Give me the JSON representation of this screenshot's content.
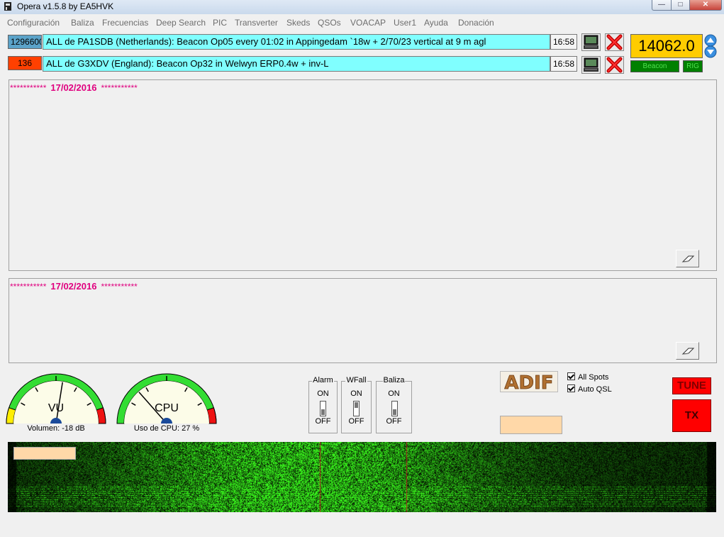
{
  "window": {
    "title": "Opera v1.5.8    by EA5HVK",
    "minimize": "—",
    "maximize": "□",
    "close": "✕"
  },
  "menu": [
    "Configuración",
    "Baliza",
    "Frecuencias",
    "Deep Search",
    "PIC",
    "Transverter",
    "Skeds",
    "QSOs",
    "VOACAP",
    "User1",
    "Ayuda",
    "Donación"
  ],
  "spots": [
    {
      "freq": "1296600",
      "freq_bg": "#5ba3c9",
      "message": "ALL de PA1SDB (Netherlands): Beacon Op05 every 01:02 in Appingedam `18w + 2/70/23 vertical at 9 m agl",
      "time": "16:58"
    },
    {
      "freq": "136",
      "freq_bg": "#ff4000",
      "message": "ALL de G3XDV (England): Beacon Op32 in Welwyn ERP0.4w + inv-L",
      "time": "16:58"
    }
  ],
  "frequency_display": "14062.0",
  "buttons": {
    "beacon": "Beacon",
    "rig": "RIG",
    "tune": "TUNE",
    "tx": "TX"
  },
  "panels": {
    "decode": {
      "stars_left": "***********",
      "date": "17/02/2016",
      "stars_right": "***********"
    },
    "log": {
      "stars_left": "***********",
      "date": "17/02/2016",
      "stars_right": "***********"
    }
  },
  "gauges": {
    "vu": {
      "name": "VU",
      "caption": "Volumen: -18 dB",
      "level": 0.55
    },
    "cpu": {
      "name": "CPU",
      "caption": "Uso de CPU: 27 %",
      "level": 0.27
    }
  },
  "switches": [
    {
      "name": "Alarm",
      "on": "ON",
      "off": "OFF"
    },
    {
      "name": "WFall",
      "on": "ON",
      "off": "OFF"
    },
    {
      "name": "Baliza",
      "on": "ON",
      "off": "OFF"
    }
  ],
  "adif_logo": "ADIF",
  "checkboxes": [
    {
      "label": "All Spots",
      "checked": true
    },
    {
      "label": "Auto QSL",
      "checked": true
    }
  ],
  "colors": {
    "cyan": "#80ffff",
    "frequency_bg": "#ffcc00",
    "button_green": "#008000",
    "button_red": "#ff0000",
    "date_magenta": "#e0007f"
  }
}
